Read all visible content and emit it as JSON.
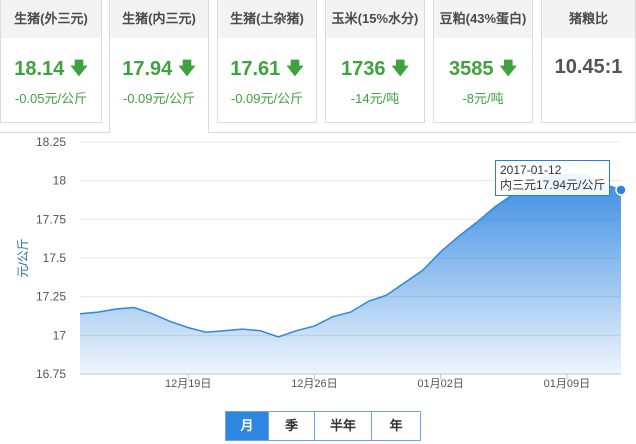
{
  "cards": [
    {
      "title": "生猪(外三元)",
      "value": "18.14",
      "trend": "down",
      "change": "-0.05元/公斤"
    },
    {
      "title": "生猪(内三元)",
      "value": "17.94",
      "trend": "down",
      "change": "-0.09元/公斤",
      "active": true
    },
    {
      "title": "生猪(土杂猪)",
      "value": "17.61",
      "trend": "down",
      "change": "-0.09元/公斤"
    },
    {
      "title": "玉米(15%水分)",
      "value": "1736",
      "trend": "down",
      "change": "-14元/吨"
    },
    {
      "title": "豆粕(43%蛋白)",
      "value": "3585",
      "trend": "down",
      "change": "-8元/吨"
    },
    {
      "title": "猪粮比",
      "value": "10.45:1",
      "trend": "none",
      "change": ""
    }
  ],
  "colors": {
    "down": "#3ea33e",
    "line": "#2f86e0",
    "accent": "#2f86e0"
  },
  "icons": {
    "down_arrow": "arrow-down-icon"
  },
  "tooltip": {
    "date": "2017-01-12",
    "text": "内三元17.94元/公斤"
  },
  "range_tabs": [
    {
      "label": "月",
      "active": true
    },
    {
      "label": "季",
      "active": false
    },
    {
      "label": "半年",
      "active": false
    },
    {
      "label": "年",
      "active": false
    }
  ],
  "chart_data": {
    "type": "area",
    "ylabel": "元/公斤",
    "ylim": [
      16.75,
      18.25
    ],
    "yticks": [
      16.75,
      17,
      17.25,
      17.5,
      17.75,
      18,
      18.25
    ],
    "ytick_labels": [
      "16.75",
      "17",
      "17.25",
      "17.5",
      "17.75",
      "18",
      "18.25"
    ],
    "xticks": [
      {
        "x": "2016-12-19",
        "label": "12月19日"
      },
      {
        "x": "2016-12-26",
        "label": "12月26日"
      },
      {
        "x": "2017-01-02",
        "label": "01月02日"
      },
      {
        "x": "2017-01-09",
        "label": "01月09日"
      }
    ],
    "grid": "horizontal",
    "series": [
      {
        "x": [
          "2016-12-13",
          "2016-12-14",
          "2016-12-15",
          "2016-12-16",
          "2016-12-17",
          "2016-12-18",
          "2016-12-19",
          "2016-12-20",
          "2016-12-21",
          "2016-12-22",
          "2016-12-23",
          "2016-12-24",
          "2016-12-25",
          "2016-12-26",
          "2016-12-27",
          "2016-12-28",
          "2016-12-29",
          "2016-12-30",
          "2016-12-31",
          "2017-01-01",
          "2017-01-02",
          "2017-01-03",
          "2017-01-04",
          "2017-01-05",
          "2017-01-06",
          "2017-01-07",
          "2017-01-08",
          "2017-01-09",
          "2017-01-10",
          "2017-01-11",
          "2017-01-12"
        ],
        "y": [
          17.14,
          17.15,
          17.17,
          17.18,
          17.14,
          17.09,
          17.05,
          17.02,
          17.03,
          17.04,
          17.03,
          16.99,
          17.03,
          17.06,
          17.12,
          17.15,
          17.22,
          17.26,
          17.34,
          17.42,
          17.54,
          17.64,
          17.73,
          17.83,
          17.91,
          17.98,
          18.03,
          18.04,
          18.04,
          17.98,
          17.94
        ]
      }
    ]
  }
}
